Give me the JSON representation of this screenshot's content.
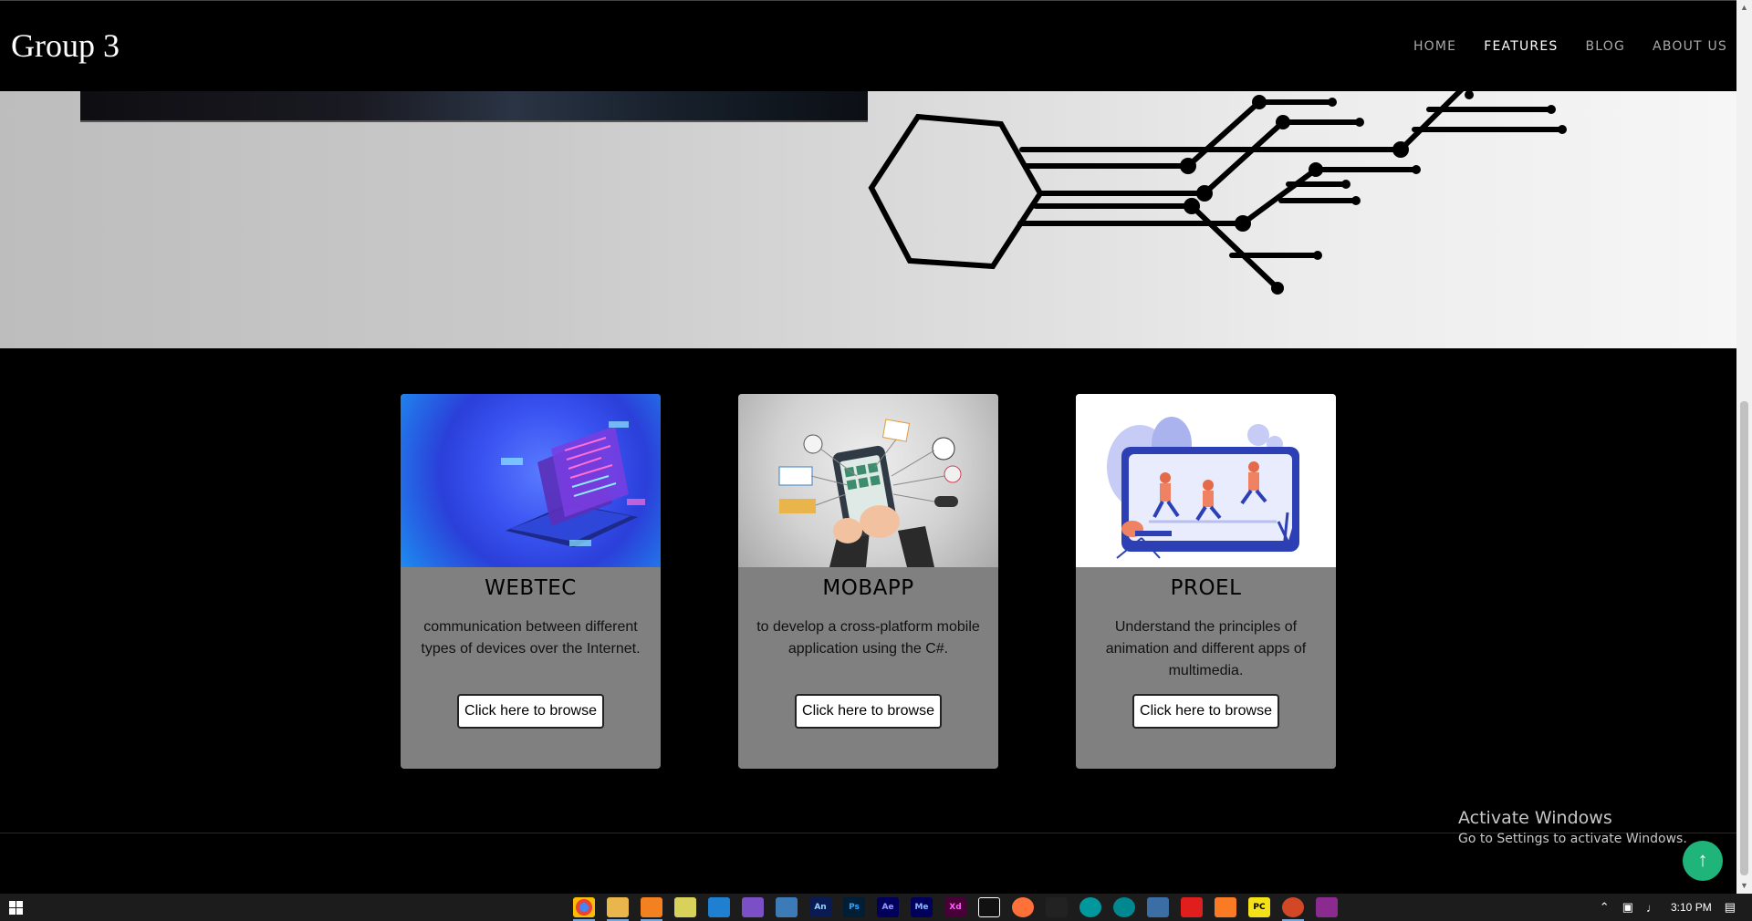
{
  "header": {
    "logo": "Group 3",
    "nav": [
      {
        "label": "HOME",
        "active": false
      },
      {
        "label": "FEATURES",
        "active": true
      },
      {
        "label": "BLOG",
        "active": false
      },
      {
        "label": "ABOUT US",
        "active": false
      }
    ]
  },
  "cards": [
    {
      "title": "WEBTEC",
      "description": "communication between different types of devices over the Internet.",
      "button": "Click here to browse"
    },
    {
      "title": "MOBAPP",
      "description": "to develop a cross-platform mobile application using the C#.",
      "button": "Click here to browse"
    },
    {
      "title": "PROEL",
      "description": "Understand the principles of animation and different apps of multimedia.",
      "button": "Click here to browse"
    }
  ],
  "watermark": {
    "line1": "Activate Windows",
    "line2": "Go to Settings to activate Windows."
  },
  "scroll_top_icon": "arrow-up-icon",
  "taskbar": {
    "apps": [
      "chrome",
      "file-explorer",
      "sublime-text",
      "notepad",
      "vscode",
      "visual-studio",
      "python",
      "animate",
      "photoshop",
      "after-effects",
      "media-encoder",
      "xd",
      "capcut",
      "firefox",
      "inkscape",
      "arduino",
      "arduino-ide",
      "snipping-tool",
      "acrobat",
      "xampp",
      "pycharm",
      "powerpoint",
      "winrar"
    ],
    "clock": "3:10 PM"
  },
  "colors": {
    "accent": "#1fb57a",
    "card_bg": "#808080"
  }
}
